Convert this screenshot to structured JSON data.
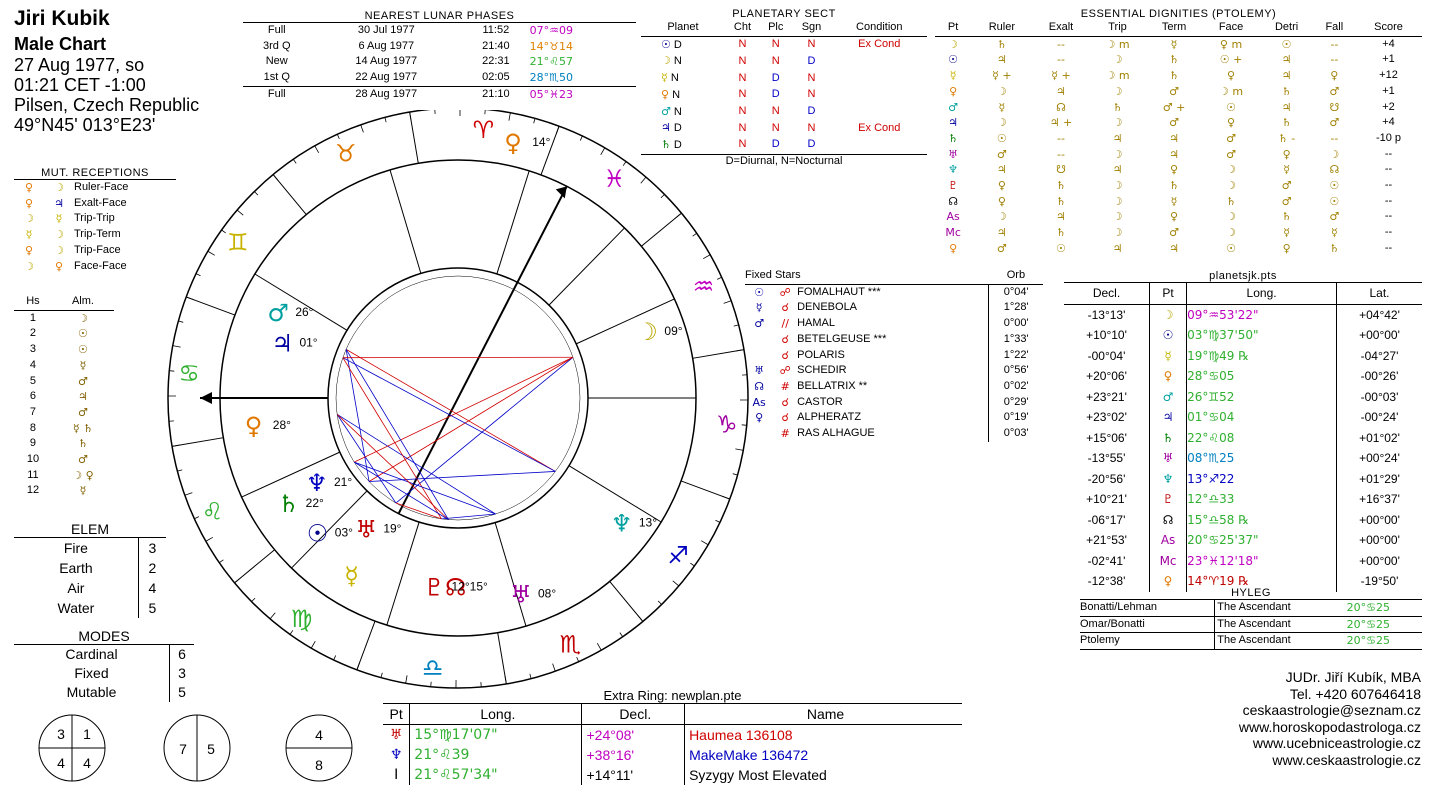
{
  "header": {
    "name": "Jiri Kubik",
    "chart_type": "Male Chart",
    "date": "27 Aug 1977, so",
    "time": "01:21  CET -1:00",
    "place": "Pilsen, Czech Republic",
    "coords": "49°N45' 013°E23'"
  },
  "lunar": {
    "title": "NEAREST LUNAR PHASES",
    "rows": [
      {
        "phase": "Full",
        "date": "30 Jul 1977",
        "time": "11:52",
        "pos": "07°♒09",
        "color": "#c000c0"
      },
      {
        "phase": "3rd Q",
        "date": "6 Aug 1977",
        "time": "21:40",
        "pos": "14°♉14",
        "color": "#e08000"
      },
      {
        "phase": "New",
        "date": "14 Aug 1977",
        "time": "22:31",
        "pos": "21°♌57",
        "color": "#30b030"
      },
      {
        "phase": "1st Q",
        "date": "22 Aug 1977",
        "time": "02:05",
        "pos": "28°♏50",
        "color": "#0080c0"
      },
      {
        "phase": "Full",
        "date": "28 Aug 1977",
        "time": "21:10",
        "pos": "05°♓23",
        "color": "#c000c0"
      }
    ]
  },
  "sect": {
    "title": "PLANETARY SECT",
    "headers": [
      "Planet",
      "Cht",
      "Plc",
      "Sgn",
      "Condition"
    ],
    "rows": [
      {
        "g": "☉",
        "c": "#00008b",
        "p": "D",
        "cht": "N",
        "plc": "N",
        "sgn": "N",
        "cond": "Ex Cond"
      },
      {
        "g": "☽",
        "c": "#b8a600",
        "p": "N",
        "cht": "N",
        "plc": "N",
        "sgn": "D",
        "cond": ""
      },
      {
        "g": "☿",
        "c": "#c8b400",
        "p": "N",
        "cht": "N",
        "plc": "D",
        "sgn": "N",
        "cond": ""
      },
      {
        "g": "♀",
        "c": "#e07800",
        "p": "N",
        "cht": "N",
        "plc": "D",
        "sgn": "N",
        "cond": ""
      },
      {
        "g": "♂",
        "c": "#00a0a0",
        "p": "N",
        "cht": "N",
        "plc": "N",
        "sgn": "D",
        "cond": ""
      },
      {
        "g": "♃",
        "c": "#0000a0",
        "p": "D",
        "cht": "N",
        "plc": "N",
        "sgn": "N",
        "cond": "Ex Cond"
      },
      {
        "g": "♄",
        "c": "#008000",
        "p": "D",
        "cht": "N",
        "plc": "D",
        "sgn": "D",
        "cond": ""
      }
    ],
    "footnote": "D=Diurnal, N=Nocturnal"
  },
  "dignities": {
    "title": "ESSENTIAL DIGNITIES (PTOLEMY)",
    "headers": [
      "Pt",
      "Ruler",
      "Exalt",
      "Trip",
      "Term",
      "Face",
      "Detri",
      "Fall",
      "Score"
    ],
    "rows": [
      {
        "pt": "☽",
        "c": "#b8a600",
        "ruler": "♄",
        "exalt": "--",
        "trip": "☽ m",
        "term": "☿",
        "face": "♀ m",
        "detri": "☉",
        "fall": "--",
        "score": "+4"
      },
      {
        "pt": "☉",
        "c": "#00008b",
        "ruler": "♃",
        "exalt": "--",
        "trip": "☽",
        "term": "♄",
        "face": "☉ +",
        "detri": "♃",
        "fall": "--",
        "score": "+1"
      },
      {
        "pt": "☿",
        "c": "#c8b400",
        "ruler": "☿ +",
        "exalt": "☿ +",
        "trip": "☽ m",
        "term": "♄",
        "face": "♀",
        "detri": "♃",
        "fall": "♀",
        "score": "+12"
      },
      {
        "pt": "♀",
        "c": "#e07800",
        "ruler": "☽",
        "exalt": "♃",
        "trip": "☽",
        "term": "♂",
        "face": "☽ m",
        "detri": "♄",
        "fall": "♂",
        "score": "+1"
      },
      {
        "pt": "♂",
        "c": "#00a0a0",
        "ruler": "☿",
        "exalt": "☊",
        "trip": "♄",
        "term": "♂ +",
        "face": "☉",
        "detri": "♃",
        "fall": "☋",
        "score": "+2"
      },
      {
        "pt": "♃",
        "c": "#0000a0",
        "ruler": "☽",
        "exalt": "♃ +",
        "trip": "☽",
        "term": "♂",
        "face": "♀",
        "detri": "♄",
        "fall": "♂",
        "score": "+4"
      },
      {
        "pt": "♄",
        "c": "#008000",
        "ruler": "☉",
        "exalt": "--",
        "trip": "♃",
        "term": "♃",
        "face": "♂",
        "detri": "♄ -",
        "fall": "--",
        "score": "-10 p"
      },
      {
        "pt": "♅",
        "c": "#a000a0",
        "ruler": "♂",
        "exalt": "--",
        "trip": "☽",
        "term": "♃",
        "face": "♂",
        "detri": "♀",
        "fall": "☽",
        "score": "--"
      },
      {
        "pt": "♆",
        "c": "#00a0a0",
        "ruler": "♃",
        "exalt": "☋",
        "trip": "♃",
        "term": "♀",
        "face": "☽",
        "detri": "☿",
        "fall": "☊",
        "score": "--"
      },
      {
        "pt": "♇",
        "c": "#c00000",
        "ruler": "♀",
        "exalt": "♄",
        "trip": "☽",
        "term": "♄",
        "face": "☽",
        "detri": "♂",
        "fall": "☉",
        "score": "--"
      },
      {
        "pt": "☊",
        "c": "#000000",
        "ruler": "♀",
        "exalt": "♄",
        "trip": "☽",
        "term": "☿",
        "face": "♄",
        "detri": "♂",
        "fall": "☉",
        "score": "--"
      },
      {
        "pt": "As",
        "c": "#a000a0",
        "ruler": "☽",
        "exalt": "♃",
        "trip": "☽",
        "term": "♀",
        "face": "☽",
        "detri": "♄",
        "fall": "♂",
        "score": "--"
      },
      {
        "pt": "Mc",
        "c": "#a000a0",
        "ruler": "♃",
        "exalt": "♄",
        "trip": "☽",
        "term": "♂",
        "face": "☽",
        "detri": "☿",
        "fall": "☿",
        "score": "--"
      },
      {
        "pt": "♀",
        "c": "#e07800",
        "ruler": "♂",
        "exalt": "☉",
        "trip": "♃",
        "term": "♃",
        "face": "☉",
        "detri": "♀",
        "fall": "♄",
        "score": "--"
      }
    ]
  },
  "fixed_stars": {
    "title": "Fixed Stars",
    "orb_label": "Orb",
    "rows": [
      {
        "pt": "☉",
        "asp": "☍",
        "star": "FOMALHAUT ***",
        "orb": "0°04'"
      },
      {
        "pt": "☿",
        "asp": "☌",
        "star": "DENEBOLA",
        "orb": "1°28'"
      },
      {
        "pt": "♂",
        "asp": "//",
        "star": "HAMAL",
        "orb": "0°00'"
      },
      {
        "pt": "",
        "asp": "☌",
        "star": "BETELGEUSE ***",
        "orb": "1°33'"
      },
      {
        "pt": "",
        "asp": "☌",
        "star": "POLARIS",
        "orb": "1°22'"
      },
      {
        "pt": "♅",
        "asp": "☍",
        "star": "SCHEDIR",
        "orb": "0°56'"
      },
      {
        "pt": "☊",
        "asp": "#",
        "star": "BELLATRIX **",
        "orb": "0°02'"
      },
      {
        "pt": "As",
        "asp": "☌",
        "star": "CASTOR",
        "orb": "0°29'"
      },
      {
        "pt": "♀",
        "asp": "☌",
        "star": "ALPHERATZ",
        "orb": "0°19'"
      },
      {
        "pt": "",
        "asp": "#",
        "star": "RAS ALHAGUE",
        "orb": "0°03'"
      }
    ]
  },
  "pts": {
    "title": "planetsjk.pts",
    "headers": [
      "Decl.",
      "Pt",
      "Long.",
      "Lat."
    ],
    "rows": [
      {
        "decl": "-13°13'",
        "pt": "☽",
        "c": "#b8a600",
        "long": "09°♒53'22\"",
        "lc": "#c000c0",
        "lat": "+04°42'"
      },
      {
        "decl": "+10°10'",
        "pt": "☉",
        "c": "#00008b",
        "long": "03°♍37'50\"",
        "lc": "#30b030",
        "lat": "+00°00'"
      },
      {
        "decl": "-00°04'",
        "pt": "☿",
        "c": "#c8b400",
        "long": "19°♍49 ℞",
        "lc": "#30b030",
        "lat": "-04°27'"
      },
      {
        "decl": "+20°06'",
        "pt": "♀",
        "c": "#e07800",
        "long": "28°♋05",
        "lc": "#30b030",
        "lat": "-00°26'"
      },
      {
        "decl": "+23°21'",
        "pt": "♂",
        "c": "#00a0a0",
        "long": "26°♊52",
        "lc": "#30b030",
        "lat": "-00°03'"
      },
      {
        "decl": "+23°02'",
        "pt": "♃",
        "c": "#0000a0",
        "long": "01°♋04",
        "lc": "#30b030",
        "lat": "-00°24'"
      },
      {
        "decl": "+15°06'",
        "pt": "♄",
        "c": "#008000",
        "long": "22°♌08",
        "lc": "#30b030",
        "lat": "+01°02'"
      },
      {
        "decl": "-13°55'",
        "pt": "♅",
        "c": "#a000a0",
        "long": "08°♏25",
        "lc": "#0080c0",
        "lat": "+00°24'"
      },
      {
        "decl": "-20°56'",
        "pt": "♆",
        "c": "#00a0a0",
        "long": "13°♐22",
        "lc": "#0000c0",
        "lat": "+01°29'"
      },
      {
        "decl": "+10°21'",
        "pt": "♇",
        "c": "#c00000",
        "long": "12°♎33",
        "lc": "#30b030",
        "lat": "+16°37'"
      },
      {
        "decl": "-06°17'",
        "pt": "☊",
        "c": "#000000",
        "long": "15°♎58 ℞",
        "lc": "#30b030",
        "lat": "+00°00'"
      },
      {
        "decl": "+21°53'",
        "pt": "As",
        "c": "#a000a0",
        "long": "20°♋25'37\"",
        "lc": "#30b030",
        "lat": "+00°00'"
      },
      {
        "decl": "-02°41'",
        "pt": "Mc",
        "c": "#a000a0",
        "long": "23°♓12'18\"",
        "lc": "#c000c0",
        "lat": "+00°00'"
      },
      {
        "decl": "-12°38'",
        "pt": "♀",
        "c": "#e07800",
        "long": "14°♈19 ℞",
        "lc": "#c00000",
        "lat": "-19°50'"
      }
    ]
  },
  "hyleg": {
    "title": "HYLEG",
    "rows": [
      {
        "method": "Bonatti/Lehman",
        "value": "The Ascendant",
        "pos": "20°♋25"
      },
      {
        "method": "Omar/Bonatti",
        "value": "The Ascendant",
        "pos": "20°♋25"
      },
      {
        "method": "Ptolemy",
        "value": "The Ascendant",
        "pos": "20°♋25"
      }
    ]
  },
  "mut_receptions": {
    "title": "MUT. RECEPTIONS",
    "rows": [
      {
        "a": "♀",
        "b": "☽",
        "label": "Ruler-Face"
      },
      {
        "a": "♀",
        "b": "♃",
        "label": "Exalt-Face"
      },
      {
        "a": "☽",
        "b": "☿",
        "label": "Trip-Trip"
      },
      {
        "a": "☿",
        "b": "☽",
        "label": "Trip-Term"
      },
      {
        "a": "♀",
        "b": "☽",
        "label": "Trip-Face"
      },
      {
        "a": "☽",
        "b": "♀",
        "label": "Face-Face"
      }
    ]
  },
  "almuten": {
    "headers": [
      "Hs",
      "Alm."
    ],
    "rows": [
      {
        "h": "1",
        "g": "☽"
      },
      {
        "h": "2",
        "g": "☉"
      },
      {
        "h": "3",
        "g": "☉"
      },
      {
        "h": "4",
        "g": "☿"
      },
      {
        "h": "5",
        "g": "♂"
      },
      {
        "h": "6",
        "g": "♃"
      },
      {
        "h": "7",
        "g": "♂"
      },
      {
        "h": "8",
        "g": "☿ ♄"
      },
      {
        "h": "9",
        "g": "♄"
      },
      {
        "h": "10",
        "g": "♂"
      },
      {
        "h": "11",
        "g": "☽ ♀"
      },
      {
        "h": "12",
        "g": "☿"
      }
    ]
  },
  "elements": {
    "title": "ELEM",
    "rows": [
      {
        "k": "Fire",
        "v": "3"
      },
      {
        "k": "Earth",
        "v": "2"
      },
      {
        "k": "Air",
        "v": "4"
      },
      {
        "k": "Water",
        "v": "5"
      }
    ]
  },
  "modes": {
    "title": "MODES",
    "rows": [
      {
        "k": "Cardinal",
        "v": "6"
      },
      {
        "k": "Fixed",
        "v": "3"
      },
      {
        "k": "Mutable",
        "v": "5"
      }
    ]
  },
  "quadrants": {
    "q1": {
      "tl": "3",
      "tr": "1",
      "bl": "4",
      "br": "4"
    },
    "q2": {
      "l": "7",
      "r": "5"
    },
    "q3": {
      "t": "4",
      "b": "8"
    }
  },
  "extra_ring": {
    "title": "Extra Ring: newplan.pte",
    "headers": [
      "Pt",
      "Long.",
      "Decl.",
      "Name"
    ],
    "rows": [
      {
        "pt": "♅",
        "pc": "#c00000",
        "long": "15°♍17'07\"",
        "lc": "#30b030",
        "decl": "+24°08'",
        "dc": "#c000c0",
        "name": "Haumea 136108",
        "nc": "#d00000"
      },
      {
        "pt": "♆",
        "pc": "#0000c0",
        "long": "21°♌39",
        "lc": "#30b030",
        "decl": "+38°16'",
        "dc": "#c000c0",
        "name": "MakeMake 136472",
        "nc": "#0000c0"
      },
      {
        "pt": "I",
        "pc": "#000000",
        "long": "21°♌57'34\"",
        "lc": "#30b030",
        "decl": "+14°11'",
        "dc": "#000000",
        "name": "Syzygy Most Elevated",
        "nc": "#000000"
      }
    ]
  },
  "contact": {
    "lines": [
      "JUDr. Jiří Kubík, MBA",
      "Tel. +420 607646418",
      "ceskaastrologie@seznam.cz",
      "www.horoskopodastrologa.cz",
      "www.ucebniceastrologie.cz",
      "www.ceskaastrologie.cz"
    ]
  },
  "wheel": {
    "signs": [
      {
        "g": "♈",
        "c": "#d00000",
        "label": "aries"
      },
      {
        "g": "♉",
        "c": "#e07800",
        "label": "taurus"
      },
      {
        "g": "♊",
        "c": "#c8b400",
        "label": "gemini"
      },
      {
        "g": "♋",
        "c": "#30b030",
        "label": "cancer"
      },
      {
        "g": "♌",
        "c": "#30b030",
        "label": "leo"
      },
      {
        "g": "♍",
        "c": "#30b030",
        "label": "virgo"
      },
      {
        "g": "♎",
        "c": "#0080c0",
        "label": "libra"
      },
      {
        "g": "♏",
        "c": "#c00000",
        "label": "scorpio"
      },
      {
        "g": "♐",
        "c": "#0000c0",
        "label": "sagittarius"
      },
      {
        "g": "♑",
        "c": "#a000a0",
        "label": "capricorn"
      },
      {
        "g": "♒",
        "c": "#c000c0",
        "label": "aquarius"
      },
      {
        "g": "♓",
        "c": "#c000c0",
        "label": "pisces"
      }
    ],
    "planet_labels": [
      {
        "name": "venus-14",
        "g": "♀",
        "deg": "14°",
        "c": "#e07800"
      },
      {
        "name": "mars",
        "g": "♂",
        "deg": "26°",
        "c": "#00a0a0"
      },
      {
        "name": "jupiter",
        "g": "♃",
        "deg": "01°",
        "c": "#0000a0"
      },
      {
        "name": "moon",
        "g": "☽",
        "deg": "09°",
        "c": "#b8a600"
      },
      {
        "name": "venus",
        "g": "♀",
        "deg": "28°",
        "c": "#e07800"
      },
      {
        "name": "makemake",
        "g": "♆",
        "deg": "21°",
        "c": "#0000c0"
      },
      {
        "name": "saturn",
        "g": "♄",
        "deg": "22°",
        "c": "#008000"
      },
      {
        "name": "sun",
        "g": "☉",
        "deg": "03°",
        "c": "#00008b"
      },
      {
        "name": "haumea",
        "g": "♅",
        "deg": "19°",
        "c": "#c00000"
      },
      {
        "name": "mercury",
        "g": "☿",
        "deg": "",
        "c": "#c8b400"
      },
      {
        "name": "pluto-node",
        "g": "♇☊",
        "deg": "12°15°",
        "c": "#c00000"
      },
      {
        "name": "uranus",
        "g": "♅",
        "deg": "08°",
        "c": "#a000a0"
      },
      {
        "name": "neptune",
        "g": "♆",
        "deg": "13°",
        "c": "#00a0a0"
      }
    ]
  }
}
